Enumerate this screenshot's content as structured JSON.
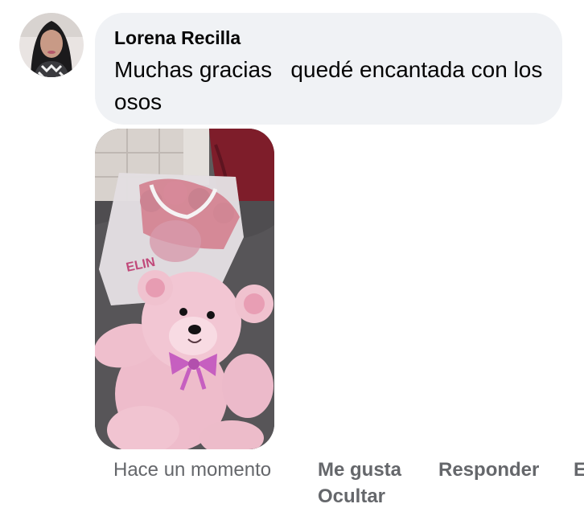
{
  "comment": {
    "author": "Lorena Recilla",
    "text": "Muchas gracias   quedé encantada con los osos",
    "avatar_icon": "profile-photo",
    "image": "pink-teddy-bear-photo"
  },
  "footer": {
    "timestamp": "Hace un momento",
    "like_label": "Me gusta",
    "reply_label": "Responder",
    "truncated_label": "E",
    "hide_label": "Ocultar"
  },
  "colors": {
    "bubble_bg": "#f0f2f5",
    "meta_text": "#65676b",
    "text": "#050505"
  }
}
